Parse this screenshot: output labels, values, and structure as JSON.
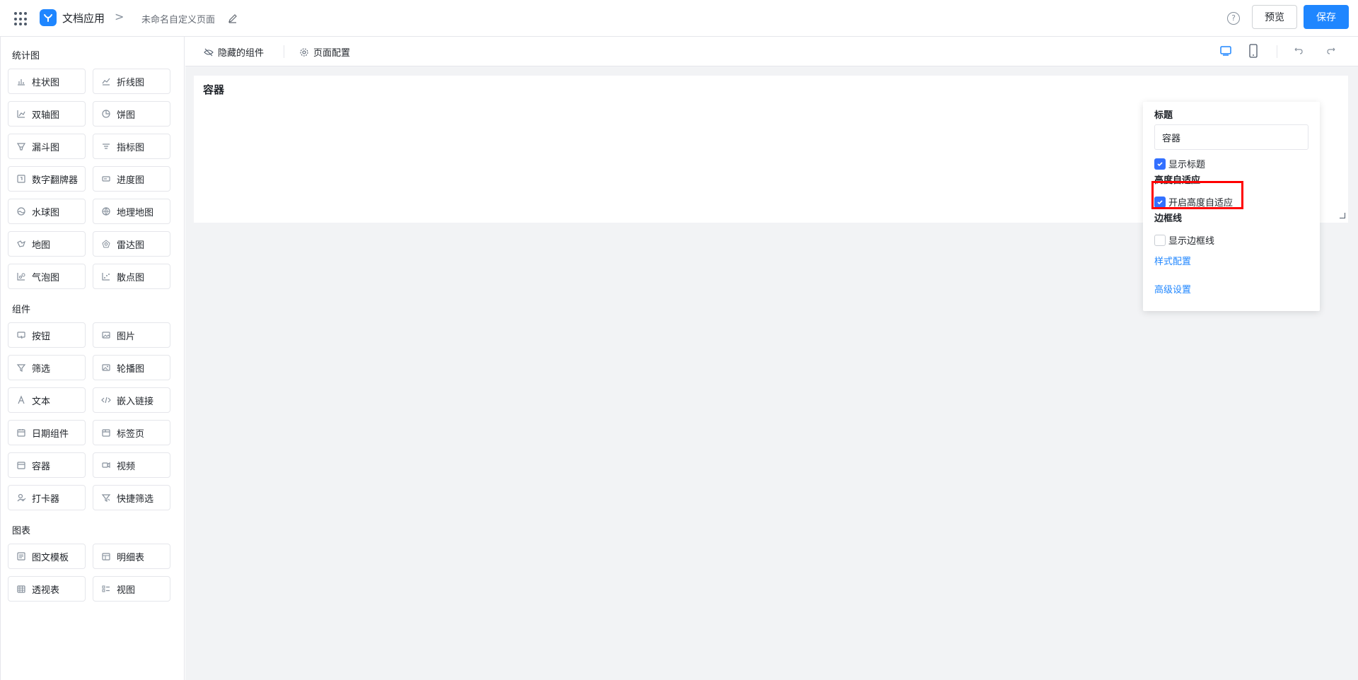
{
  "header": {
    "app_name": "文档应用",
    "breadcrumb_sep": ">",
    "page_name": "未命名自定义页面",
    "help_glyph": "?",
    "preview_label": "预览",
    "save_label": "保存",
    "accent_color": "#1f86ff"
  },
  "sidebar": {
    "sections": [
      {
        "title": "统计图",
        "items": [
          "柱状图",
          "折线图",
          "双轴图",
          "饼图",
          "漏斗图",
          "指标图",
          "数字翻牌器",
          "进度图",
          "水球图",
          "地理地图",
          "地图",
          "雷达图",
          "气泡图",
          "散点图"
        ]
      },
      {
        "title": "组件",
        "items": [
          "按钮",
          "图片",
          "筛选",
          "轮播图",
          "文本",
          "嵌入链接",
          "日期组件",
          "标签页",
          "容器",
          "视频",
          "打卡器",
          "快捷筛选"
        ]
      },
      {
        "title": "图表",
        "items": [
          "图文模板",
          "明细表",
          "透视表",
          "视图"
        ]
      }
    ]
  },
  "toolbar": {
    "hidden_components": "隐藏的组件",
    "page_config": "页面配置"
  },
  "canvas": {
    "container_title": "容器"
  },
  "panel": {
    "title_label": "标题",
    "title_value": "容器",
    "show_title_label": "显示标题",
    "show_title_checked": true,
    "auto_height_label": "高度自适应",
    "enable_auto_height_label": "开启高度自适应",
    "enable_auto_height_checked": true,
    "border_label": "边框线",
    "show_border_label": "显示边框线",
    "show_border_checked": false,
    "style_config_link": "样式配置",
    "advanced_settings_link": "高级设置"
  }
}
